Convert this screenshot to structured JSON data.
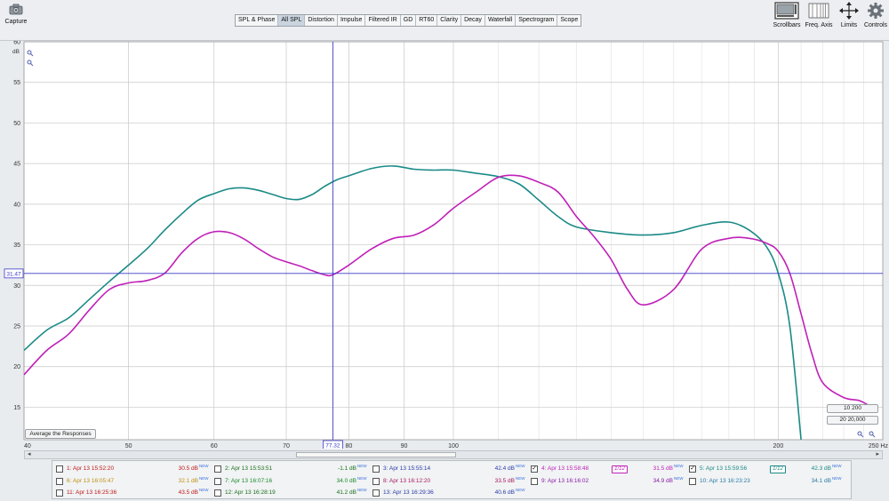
{
  "toolbar": {
    "capture_label": "Capture",
    "scrollbars_label": "Scrollbars",
    "freq_axis_label": "Freq. Axis",
    "limits_label": "Limits",
    "controls_label": "Controls"
  },
  "tabs": [
    "SPL & Phase",
    "All SPL",
    "Distortion",
    "Impulse",
    "Filtered IR",
    "GD",
    "RT60",
    "Clarity",
    "Decay",
    "Waterfall",
    "Spectrogram",
    "Scope"
  ],
  "active_tab": "All SPL",
  "average_button_label": "Average the Responses",
  "range_buttons": [
    "10 200",
    "20 20,000"
  ],
  "cursor": {
    "x_readout": "77.32",
    "y_readout": "31.47"
  },
  "colors": {
    "teal": "#1a8a86",
    "magenta": "#c020b8",
    "cursor": "#3a3ac8",
    "grid": "#c8c8c8"
  },
  "chart_data": {
    "type": "line",
    "xlabel": "Hz",
    "ylabel": "dB",
    "xscale": "log",
    "xlim": [
      40,
      250
    ],
    "ylim": [
      11,
      60
    ],
    "grid": true,
    "x_ticks": [
      40,
      50,
      60,
      70,
      80,
      90,
      100,
      200,
      250
    ],
    "x_tick_labels": [
      "40",
      "50",
      "60",
      "70",
      "80",
      "90",
      "100",
      "200",
      "250 Hz"
    ],
    "y_ticks": [
      15,
      20,
      25,
      30,
      35,
      40,
      45,
      50,
      55,
      60
    ],
    "series": [
      {
        "color": "#1a8a86",
        "x": [
          40,
          42,
          44,
          46,
          48,
          50,
          52,
          54,
          56,
          58,
          60,
          62,
          64,
          66,
          68,
          70,
          72,
          74,
          76,
          78,
          80,
          84,
          88,
          92,
          96,
          100,
          105,
          110,
          115,
          120,
          125,
          130,
          140,
          150,
          160,
          170,
          180,
          188,
          195,
          200,
          205,
          210
        ],
        "y": [
          22,
          24.5,
          26,
          28.3,
          30.5,
          32.5,
          34.5,
          36.8,
          38.8,
          40.5,
          41.3,
          41.9,
          42,
          41.7,
          41.2,
          40.7,
          40.6,
          41.2,
          42.2,
          43,
          43.5,
          44.4,
          44.7,
          44.3,
          44.2,
          44.2,
          43.8,
          43.4,
          42.5,
          40.5,
          38.5,
          37.2,
          36.5,
          36.2,
          36.5,
          37.4,
          37.8,
          36.8,
          34.8,
          31.5,
          25,
          11
        ]
      },
      {
        "color": "#c020b8",
        "x": [
          40,
          42,
          44,
          46,
          48,
          50,
          52,
          54,
          56,
          58,
          60,
          62,
          64,
          66,
          68,
          70,
          72,
          74,
          76,
          77.3,
          80,
          84,
          88,
          92,
          96,
          100,
          105,
          110,
          115,
          120,
          125,
          130,
          135,
          140,
          145,
          150,
          160,
          170,
          180,
          188,
          195,
          200,
          205,
          210,
          215,
          220,
          230,
          238,
          244
        ],
        "y": [
          19,
          22,
          24,
          27,
          29.5,
          30.3,
          30.6,
          31.5,
          34,
          35.8,
          36.6,
          36.5,
          35.7,
          34.5,
          33.5,
          32.9,
          32.4,
          31.8,
          31.3,
          31.3,
          32.5,
          34.5,
          35.8,
          36.2,
          37.5,
          39.5,
          41.5,
          43.3,
          43.5,
          42.7,
          41.5,
          38.5,
          36,
          33.2,
          29.5,
          27.6,
          29.5,
          34.5,
          35.8,
          35.8,
          35.2,
          34.2,
          31.5,
          26.5,
          21.5,
          18,
          16.2,
          15.8,
          15
        ]
      }
    ]
  },
  "legend": {
    "rows": [
      [
        {
          "label": "1: Apr 13 15:52:20",
          "value": "30.5 dB",
          "color": "#c01818",
          "checked": false
        },
        {
          "label": "2: Apr 13 15:53:51",
          "value": "-1.1 dB",
          "color": "#1a6e1a",
          "checked": false
        },
        {
          "label": "3: Apr 13 15:55:14",
          "value": "42.4 dB",
          "color": "#2a3aa8",
          "checked": false
        },
        {
          "label": "4: Apr 13 15:58:48",
          "value": "31.5 dB",
          "color": "#c020b8",
          "checked": true,
          "tag": "1/12"
        },
        {
          "label": "5: Apr 13 15:59:56",
          "value": "42.3 dB",
          "color": "#1a8a86",
          "checked": true,
          "tag": "1/12"
        }
      ],
      [
        {
          "label": "6: Apr 13 16:05:47",
          "value": "32.1 dB",
          "color": "#c09010",
          "checked": false
        },
        {
          "label": "7: Apr 13 16:07:16",
          "value": "34.0 dB",
          "color": "#1a8a2a",
          "checked": false
        },
        {
          "label": "8: Apr 13 16:12:20",
          "value": "33.5 dB",
          "color": "#a81860",
          "checked": false
        },
        {
          "label": "9: Apr 13 16:16:02",
          "value": "34.9 dB",
          "color": "#8a1aa8",
          "checked": false
        },
        {
          "label": "10: Apr 13 16:23:23",
          "value": "34.1 dB",
          "color": "#2a7aa8",
          "checked": false
        }
      ],
      [
        {
          "label": "11: Apr 13 16:25:36",
          "value": "43.5 dB",
          "color": "#c01818",
          "checked": false
        },
        {
          "label": "12: Apr 13 16:28:19",
          "value": "41.2 dB",
          "color": "#1a6e1a",
          "checked": false
        },
        {
          "label": "13: Apr 13 16:29:36",
          "value": "40.6 dB",
          "color": "#2a3aa8",
          "checked": false
        }
      ]
    ],
    "new_badge": "NEW"
  }
}
